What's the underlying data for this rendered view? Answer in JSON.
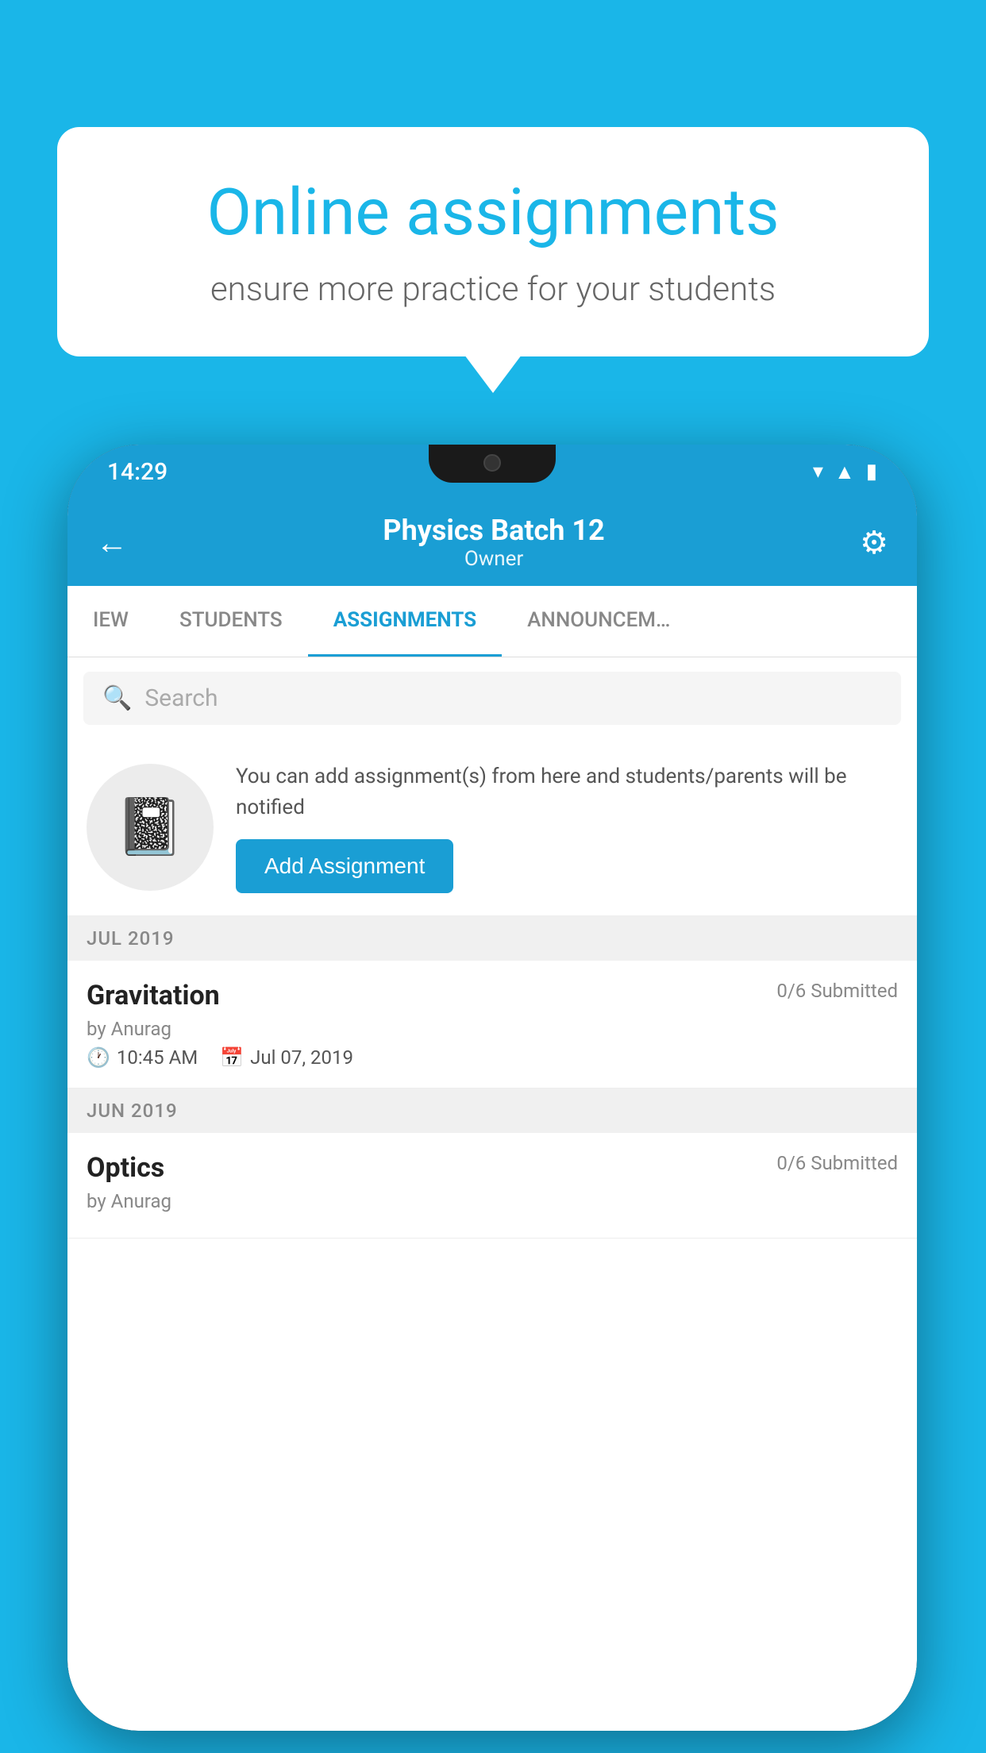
{
  "background_color": "#1ab6e8",
  "speech_bubble": {
    "title": "Online assignments",
    "subtitle": "ensure more practice for your students"
  },
  "phone": {
    "status_bar": {
      "time": "14:29",
      "icons": [
        "wifi",
        "signal",
        "battery"
      ]
    },
    "header": {
      "title": "Physics Batch 12",
      "subtitle": "Owner",
      "back_label": "←",
      "gear_label": "⚙"
    },
    "tabs": [
      {
        "label": "IEW",
        "active": false
      },
      {
        "label": "STUDENTS",
        "active": false
      },
      {
        "label": "ASSIGNMENTS",
        "active": true
      },
      {
        "label": "ANNOUNCEM…",
        "active": false
      }
    ],
    "search": {
      "placeholder": "Search"
    },
    "promo": {
      "description": "You can add assignment(s) from here and students/parents will be notified",
      "button_label": "Add Assignment"
    },
    "sections": [
      {
        "month": "JUL 2019",
        "assignments": [
          {
            "name": "Gravitation",
            "submitted": "0/6 Submitted",
            "by": "by Anurag",
            "time": "10:45 AM",
            "date": "Jul 07, 2019"
          }
        ]
      },
      {
        "month": "JUN 2019",
        "assignments": [
          {
            "name": "Optics",
            "submitted": "0/6 Submitted",
            "by": "by Anurag",
            "time": "",
            "date": ""
          }
        ]
      }
    ]
  }
}
